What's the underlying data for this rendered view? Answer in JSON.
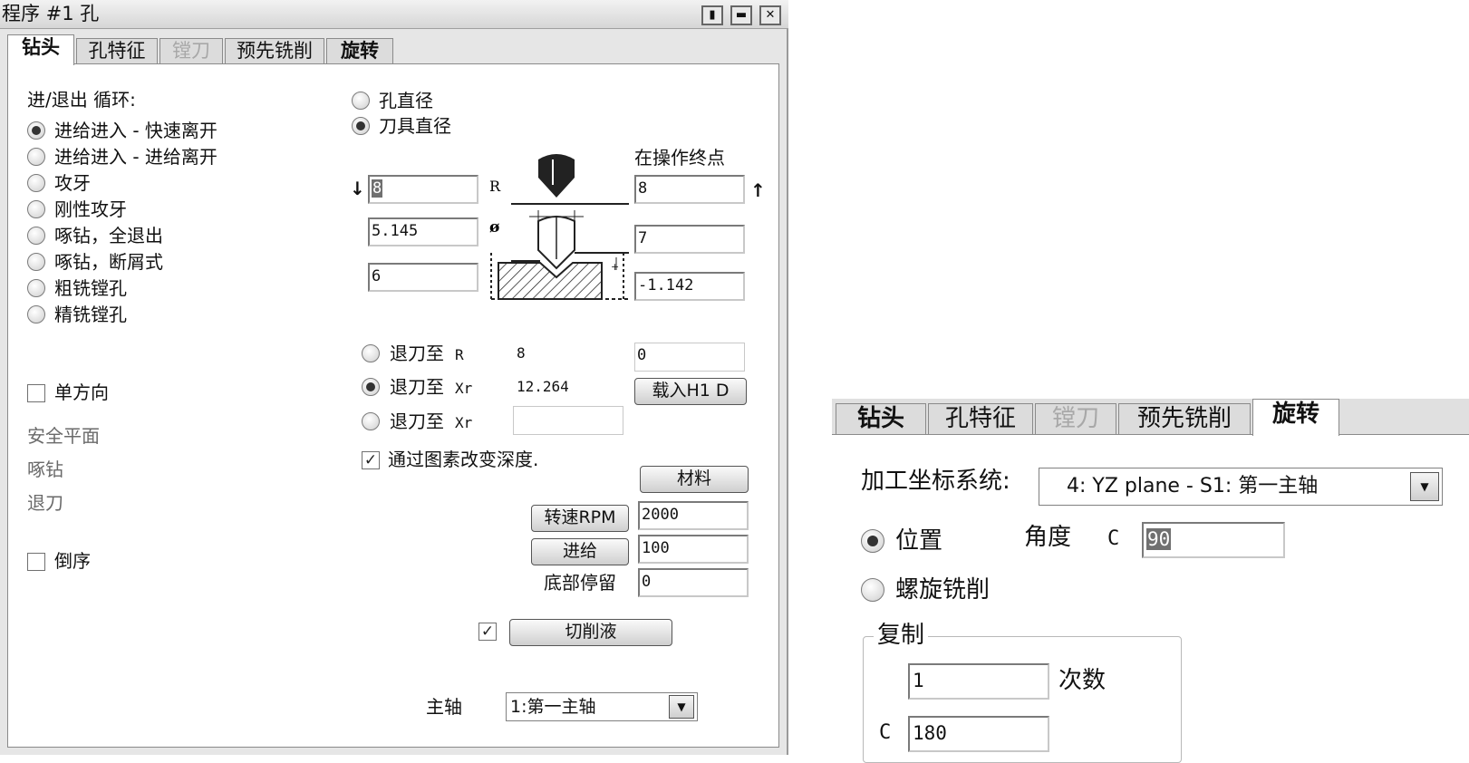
{
  "window": {
    "title": "程序 #1 孔",
    "title_buttons": [
      "pin-icon",
      "minimize-icon",
      "close-icon"
    ]
  },
  "tabs": [
    {
      "label": "钻头",
      "state": "active"
    },
    {
      "label": "孔特征",
      "state": "normal"
    },
    {
      "label": "镗刀",
      "state": "disabled"
    },
    {
      "label": "预先铣削",
      "state": "normal"
    },
    {
      "label": "旋转",
      "state": "normal"
    }
  ],
  "cycle": {
    "heading": "进/退出 循环:",
    "options": [
      {
        "label": "进给进入 - 快速离开",
        "selected": true
      },
      {
        "label": "进给进入 - 进给离开",
        "selected": false
      },
      {
        "label": "攻牙",
        "selected": false
      },
      {
        "label": "刚性攻牙",
        "selected": false
      },
      {
        "label": "啄钻，全退出",
        "selected": false
      },
      {
        "label": "啄钻，断屑式",
        "selected": false
      },
      {
        "label": "粗铣镗孔",
        "selected": false
      },
      {
        "label": "精铣镗孔",
        "selected": false
      }
    ]
  },
  "one_direction": {
    "label": "单方向",
    "checked": false
  },
  "safe_plane": "安全平面",
  "peck": "啄钻",
  "retract": "退刀",
  "reverse": {
    "label": "倒序",
    "checked": false
  },
  "diameter_mode": [
    {
      "label": "孔直径",
      "selected": false
    },
    {
      "label": "刀具直径",
      "selected": true
    }
  ],
  "operation_end_label": "在操作终点",
  "left_fields": {
    "r_value": "8",
    "diameter": "5.145",
    "depth": "6"
  },
  "diagram_labels": {
    "r": "R",
    "dia": "ø"
  },
  "right_fields": {
    "top": "8",
    "mid": "7",
    "bottom": "-1.142"
  },
  "retract_options": [
    {
      "label": "退刀至",
      "axis": "R",
      "value": "8",
      "selected": false
    },
    {
      "label": "退刀至",
      "axis": "Xr",
      "value": "12.264",
      "selected": true
    },
    {
      "label": "退刀至",
      "axis": "Xr",
      "value": "",
      "selected": false
    }
  ],
  "retract_input": "0",
  "load_button": "载入H1 D",
  "change_depth": {
    "label": "通过图素改变深度.",
    "checked": true
  },
  "material_button": "材料",
  "speed": {
    "label": "转速RPM",
    "value": "2000"
  },
  "feed": {
    "label": "进给",
    "value": "100"
  },
  "dwell": {
    "label": "底部停留",
    "value": "0"
  },
  "coolant": {
    "label": "切削液",
    "checked": true
  },
  "spindle": {
    "label": "主轴",
    "value": "1:第一主轴"
  },
  "rotation_panel": {
    "tabs": [
      {
        "label": "钻头",
        "state": "normal"
      },
      {
        "label": "孔特征",
        "state": "normal"
      },
      {
        "label": "镗刀",
        "state": "disabled"
      },
      {
        "label": "预先铣削",
        "state": "normal"
      },
      {
        "label": "旋转",
        "state": "active"
      }
    ],
    "coord_label": "加工坐标系统:",
    "coord_value": "4: YZ plane - S1: 第一主轴",
    "position": {
      "label": "位置",
      "selected": true
    },
    "angle_label": "角度",
    "angle_axis": "C",
    "angle_value": "90",
    "spiral": {
      "label": "螺旋铣削",
      "selected": false
    },
    "copy_group": "复制",
    "count_value": "1",
    "count_label": "次数",
    "copy_axis": "C",
    "copy_value": "180"
  }
}
